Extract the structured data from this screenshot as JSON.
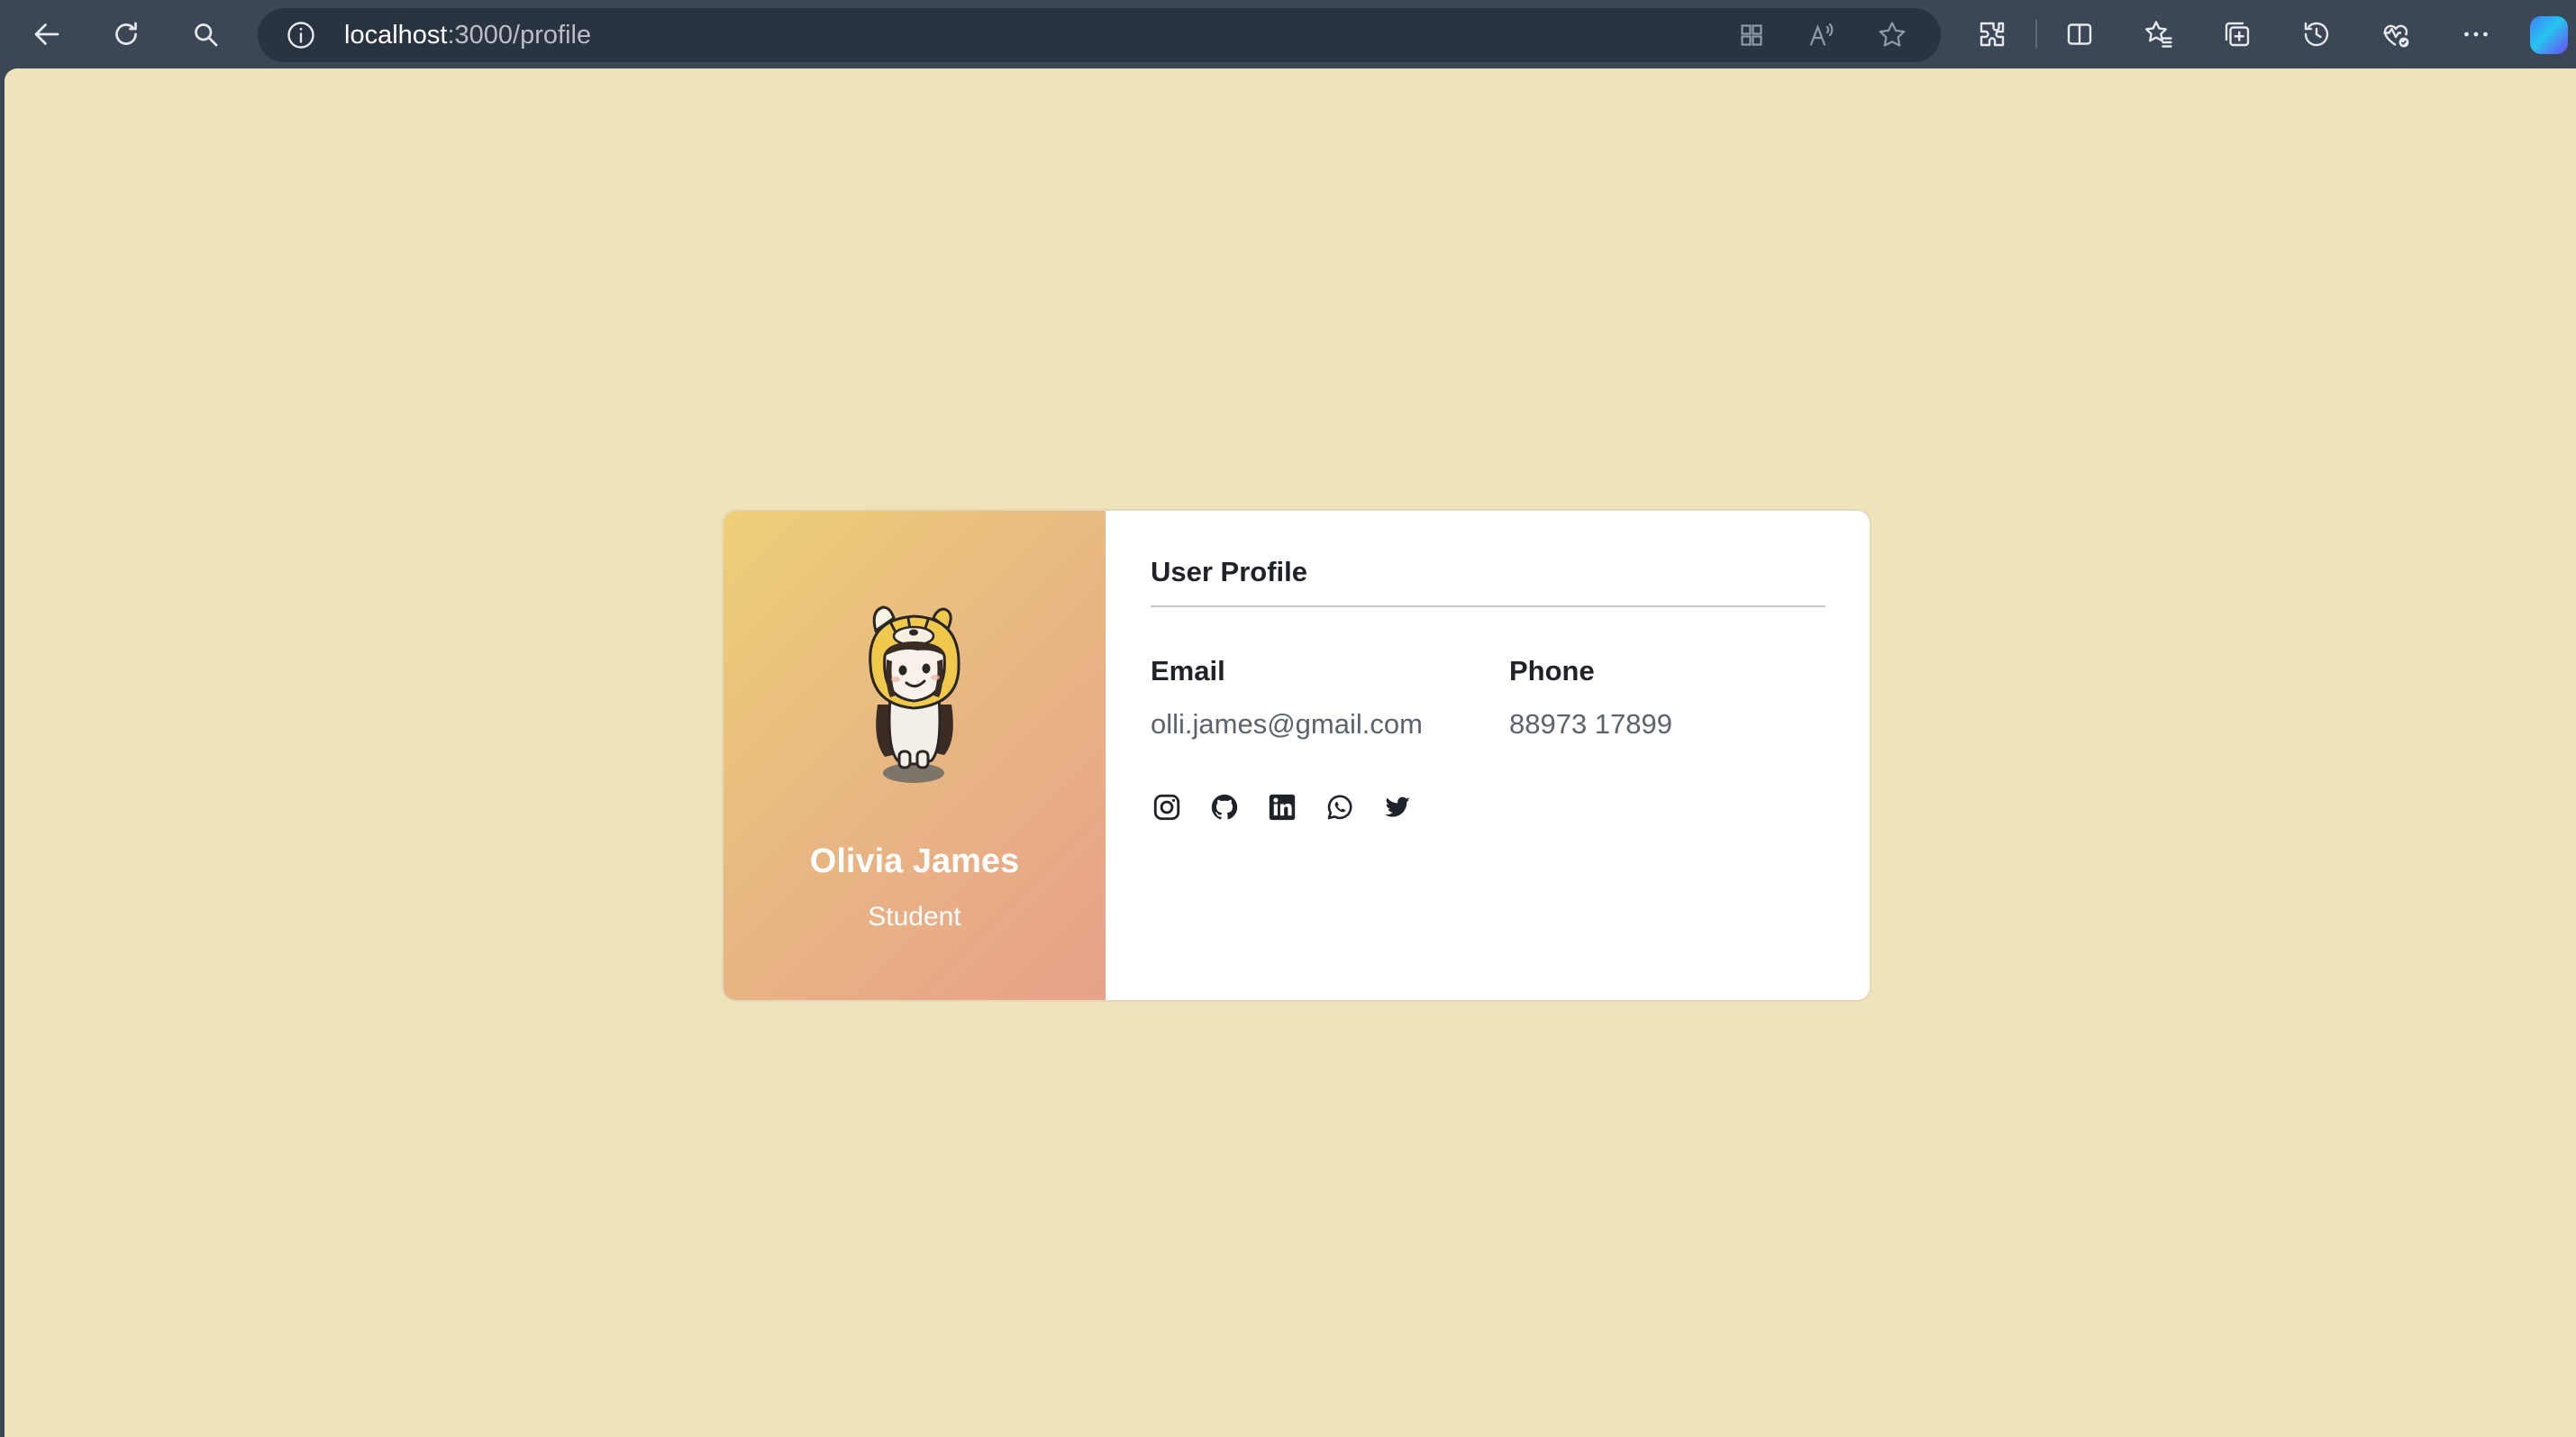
{
  "browser": {
    "url_host": "localhost",
    "url_path": ":3000/profile",
    "icons": [
      "back-icon",
      "refresh-icon",
      "search-icon",
      "site-info-icon",
      "app-available-icon",
      "read-aloud-icon",
      "favorite-star-icon",
      "extensions-icon",
      "split-screen-icon",
      "favorites-icon",
      "collections-icon",
      "history-icon",
      "browser-essentials-icon",
      "more-icon",
      "copilot-icon"
    ]
  },
  "profile": {
    "name": "Olivia James",
    "role": "Student",
    "section_title": "User Profile",
    "email_label": "Email",
    "email": "olli.james@gmail.com",
    "phone_label": "Phone",
    "phone": "88973 17899",
    "socials": [
      "instagram-icon",
      "github-icon",
      "linkedin-icon",
      "whatsapp-icon",
      "twitter-icon"
    ]
  },
  "colors": {
    "chrome": "#3b4656",
    "page_background": "#efe4b9",
    "card_gradient_start": "#ecd077",
    "card_gradient_end": "#e8a18a"
  }
}
